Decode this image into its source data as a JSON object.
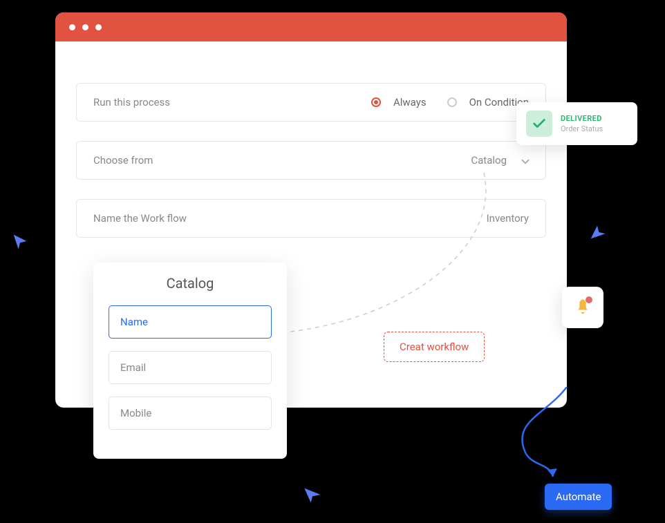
{
  "form": {
    "row1": {
      "label": "Run this process",
      "option1": "Always",
      "option2": "On Condition"
    },
    "row2": {
      "label": "Choose from",
      "value": "Catalog"
    },
    "row3": {
      "label": "Name the Work flow",
      "value": "Inventory"
    }
  },
  "catalog": {
    "title": "Catalog",
    "fields": [
      "Name",
      "Email",
      "Mobile"
    ]
  },
  "create_button": "Creat workflow",
  "delivered": {
    "status": "DELIVERED",
    "label": "Order Status"
  },
  "automate_button": "Automate"
}
